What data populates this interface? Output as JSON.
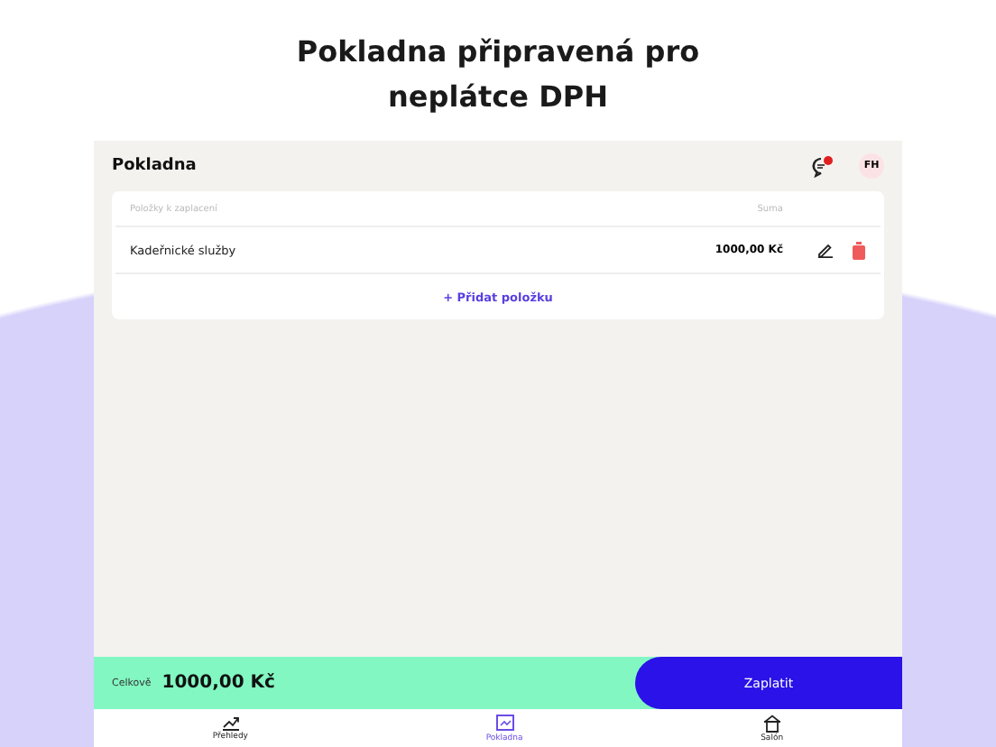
{
  "headline": "Pokladna připravená pro neplátce DPH",
  "app_title": "Pokladna",
  "notification_badge": true,
  "avatar": "FH",
  "table": {
    "columns": [
      "Položky k zaplacení",
      "Suma"
    ],
    "rows": [
      {
        "name": "Kadeřnické služby",
        "amount": "1000,00 Kč"
      }
    ],
    "add_button": "+ Přidat položku"
  },
  "total": {
    "label": "Celkově",
    "value": "1000,00 Kč"
  },
  "pay_button": "Zaplatit",
  "nav": [
    {
      "label": "Přehledy",
      "kind": "chart",
      "selected": false
    },
    {
      "label": "Pokladna",
      "kind": "receipt",
      "selected": true
    },
    {
      "label": "Salón",
      "kind": "shop",
      "selected": false
    }
  ]
}
